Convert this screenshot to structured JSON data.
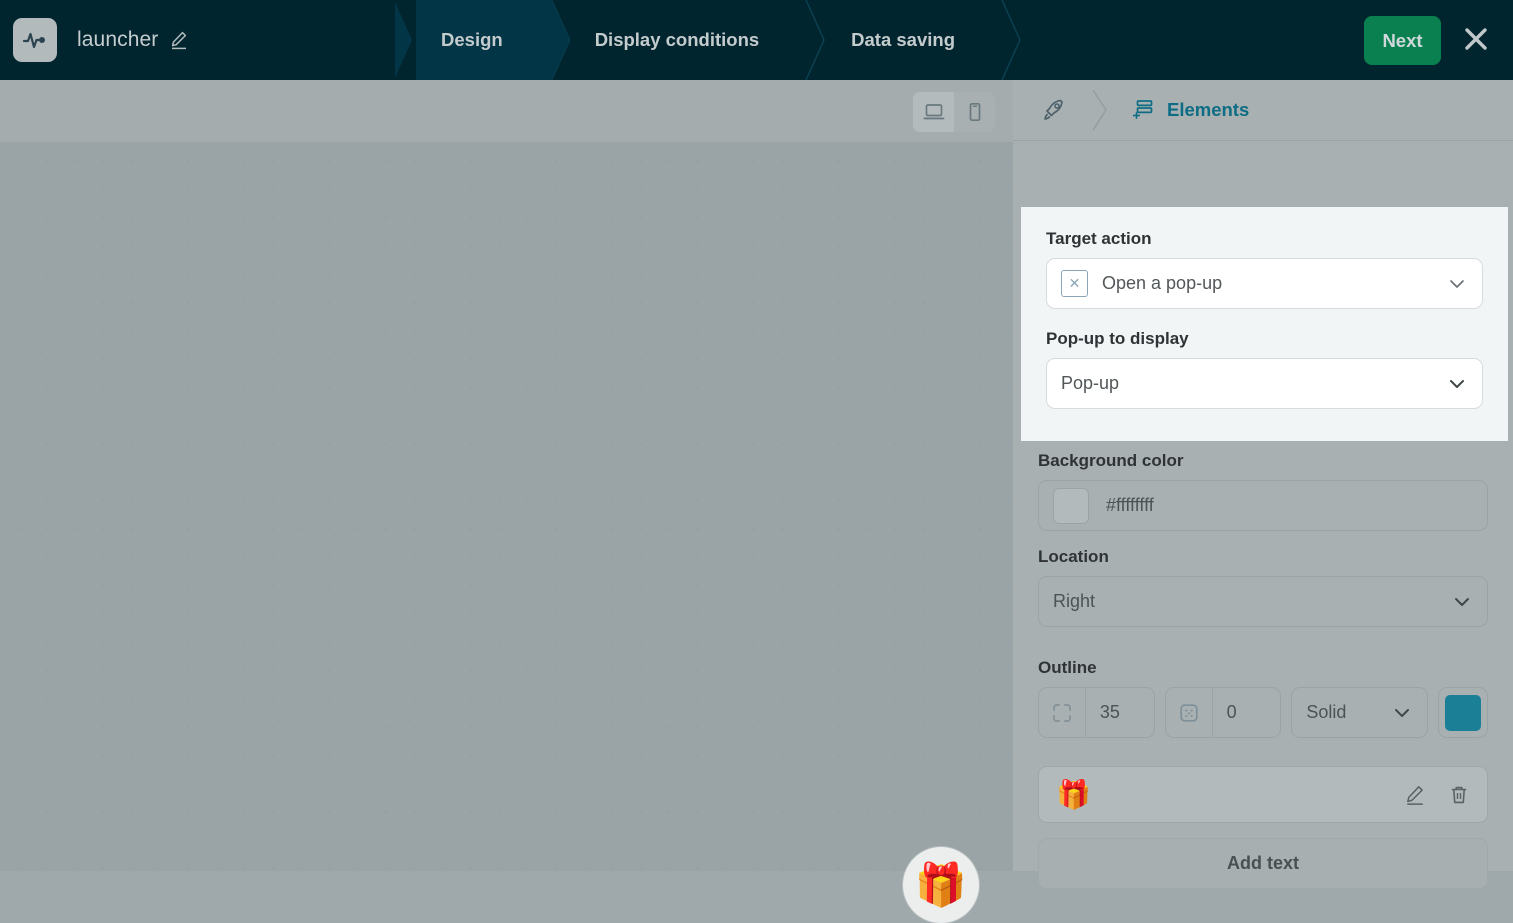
{
  "header": {
    "logo_icon": "activity-pulse-icon",
    "app_title": "launcher",
    "edit_title_icon": "pencil-icon",
    "tabs": [
      {
        "label": "Design",
        "active": true
      },
      {
        "label": "Display conditions",
        "active": false
      },
      {
        "label": "Data saving",
        "active": false
      }
    ],
    "next_label": "Next",
    "close_icon": "close-icon",
    "bg_color": "#00252f",
    "active_tab_color": "#023647",
    "next_color": "#0a8050"
  },
  "canvas": {
    "device_toggle": [
      {
        "icon": "desktop-icon",
        "label": "Desktop",
        "selected": true
      },
      {
        "icon": "mobile-icon",
        "label": "Mobile",
        "selected": false
      }
    ],
    "launcher_emoji": "🎁",
    "bg_color": "#9aa4a6"
  },
  "panel": {
    "breadcrumb": {
      "root_icon": "rocket-icon",
      "separator_icon": "chevron-right-icon",
      "current_icon": "add-layers-icon",
      "current_label": "Elements",
      "accent_color": "#0e6d84"
    },
    "target_action": {
      "label": "Target action",
      "value": "Open a pop-up",
      "icon": "broken-image-icon",
      "chevron_icon": "chevron-down-icon"
    },
    "popup_to_display": {
      "label": "Pop-up to display",
      "value": "Pop-up",
      "chevron_icon": "chevron-down-icon"
    },
    "background_color": {
      "label": "Background color",
      "value": "#ffffffff",
      "swatch_icon": "color-swatch"
    },
    "location": {
      "label": "Location",
      "value": "Right",
      "chevron_icon": "chevron-down-icon"
    },
    "outline": {
      "label": "Outline",
      "radius_icon": "corner-radius-icon",
      "radius_value": "35",
      "width_icon": "border-width-icon",
      "width_value": "0",
      "style_value": "Solid",
      "style_chevron_icon": "chevron-down-icon",
      "color_value": "#1b7f96"
    },
    "elements_list": [
      {
        "emoji": "🎁",
        "edit_icon": "pencil-icon",
        "delete_icon": "trash-icon"
      }
    ],
    "add_text_label": "Add text"
  }
}
